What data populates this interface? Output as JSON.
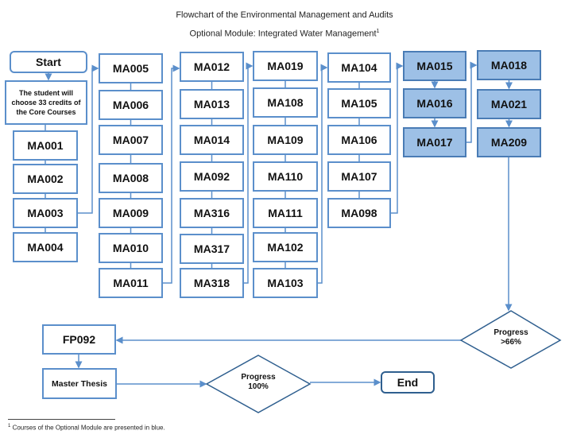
{
  "title": {
    "line1": "Flowchart of the Environmental Management and Audits",
    "line2": "Optional Module: Integrated Water Management",
    "line2_sup": "1"
  },
  "colors": {
    "border": "#5b8fcb",
    "optional_fill": "#9dc0e6",
    "optional_border": "#4a7cb5"
  },
  "start": {
    "label": "Start"
  },
  "core_note": {
    "label": "The student will choose 33 credits of the Core Courses"
  },
  "columns": [
    {
      "courses": [
        "MA001",
        "MA002",
        "MA003",
        "MA004"
      ],
      "optional": false
    },
    {
      "courses": [
        "MA005",
        "MA006",
        "MA007",
        "MA008",
        "MA009",
        "MA010",
        "MA011"
      ],
      "optional": false
    },
    {
      "courses": [
        "MA012",
        "MA013",
        "MA014",
        "MA092",
        "MA316",
        "MA317",
        "MA318"
      ],
      "optional": false
    },
    {
      "courses": [
        "MA019",
        "MA108",
        "MA109",
        "MA110",
        "MA111",
        "MA102",
        "MA103"
      ],
      "optional": false
    },
    {
      "courses": [
        "MA104",
        "MA105",
        "MA106",
        "MA107",
        "MA098"
      ],
      "optional": false
    },
    {
      "courses": [
        "MA015",
        "MA016",
        "MA017"
      ],
      "optional": true
    },
    {
      "courses": [
        "MA018",
        "MA021",
        "MA209"
      ],
      "optional": true
    }
  ],
  "decision1": {
    "line1": "Progress",
    "line2": ">66%"
  },
  "fp": {
    "label": "FP092"
  },
  "thesis": {
    "label": "Master Thesis"
  },
  "decision2": {
    "line1": "Progress",
    "line2": "100%"
  },
  "end": {
    "label": "End"
  },
  "footnote": {
    "sup": "1",
    "text": "Courses of the Optional Module are presented in blue."
  }
}
